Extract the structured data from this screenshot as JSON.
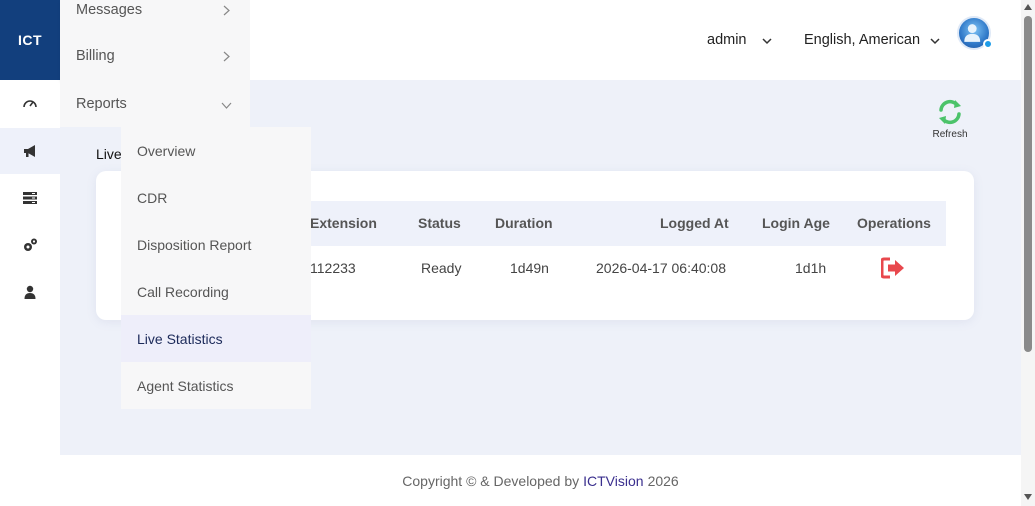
{
  "app": {
    "logo_text": "ICT"
  },
  "rail": [
    {
      "icon": "dashboard-gauge-icon"
    },
    {
      "icon": "megaphone-icon",
      "active": true
    },
    {
      "icon": "server-list-icon"
    },
    {
      "icon": "gears-icon"
    },
    {
      "icon": "user-icon"
    }
  ],
  "menu": {
    "items": [
      {
        "label": "Messages",
        "chevron": "right"
      },
      {
        "label": "Billing",
        "chevron": "right"
      },
      {
        "label": "Reports",
        "chevron": "down"
      }
    ],
    "submenu": [
      {
        "label": "Overview"
      },
      {
        "label": "CDR"
      },
      {
        "label": "Disposition Report"
      },
      {
        "label": "Call Recording"
      },
      {
        "label": "Live Statistics",
        "active": true
      },
      {
        "label": "Agent Statistics"
      }
    ]
  },
  "header": {
    "user": "admin",
    "language": "English, American"
  },
  "page": {
    "heading_visible": "Live",
    "refresh_label": "Refresh"
  },
  "table": {
    "columns": [
      "Extension",
      "Status",
      "Duration",
      "Logged At",
      "Login Age",
      "Operations"
    ],
    "rows": [
      {
        "extension": "112233",
        "status": "Ready",
        "duration": "1d49n",
        "logged_at": "2026-04-17 06:40:08",
        "login_age": "1d1h",
        "operation_icon": "logout-icon"
      }
    ]
  },
  "footer": {
    "prefix": "Copyright © & Developed by",
    "brand": "ICTVision",
    "year": "2026"
  },
  "colors": {
    "brand_blue": "#123f7d",
    "refresh_green": "#4cc36a",
    "logout_red": "#e8484d",
    "brand_text": "#3a2f8e"
  }
}
